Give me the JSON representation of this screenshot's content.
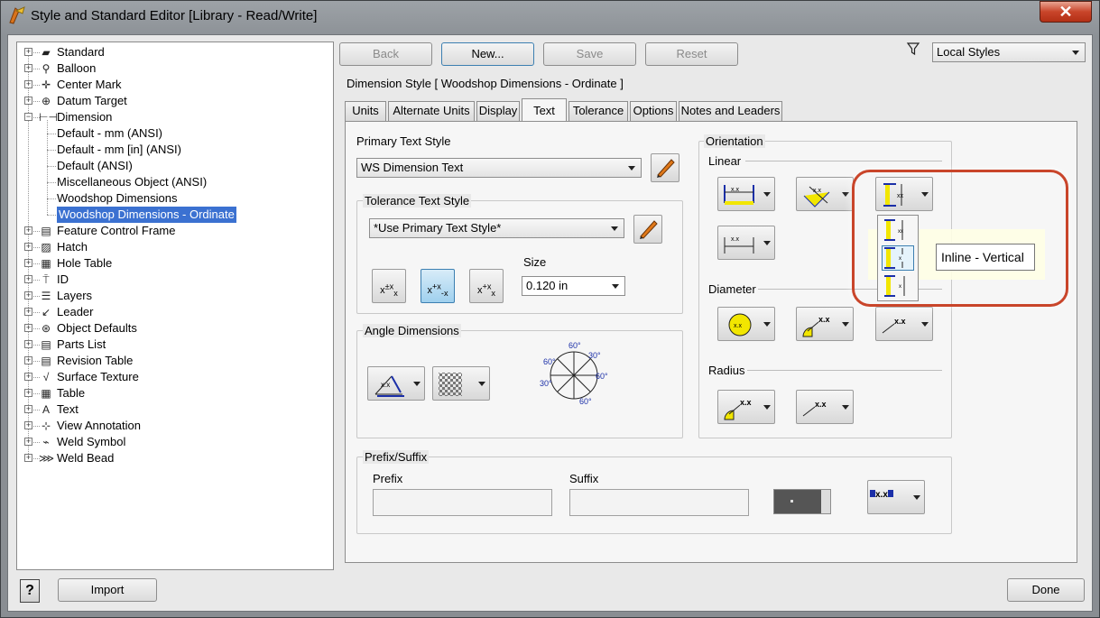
{
  "window": {
    "title": "Style and Standard Editor [Library - Read/Write]",
    "close_label": "✕"
  },
  "toolbar": {
    "back_label": "Back",
    "new_label": "New...",
    "save_label": "Save",
    "reset_label": "Reset",
    "filter_value": "Local Styles"
  },
  "tree": {
    "items": [
      {
        "label": "Standard",
        "icon": "standard-icon",
        "glyph": "▰"
      },
      {
        "label": "Balloon",
        "icon": "balloon-icon",
        "glyph": "⚲"
      },
      {
        "label": "Center Mark",
        "icon": "center-mark-icon",
        "glyph": "✛"
      },
      {
        "label": "Datum Target",
        "icon": "datum-target-icon",
        "glyph": "⊕"
      },
      {
        "label": "Dimension",
        "icon": "dimension-icon",
        "glyph": "⊢⊣"
      }
    ],
    "dimension_children": [
      {
        "label": "Default - mm (ANSI)"
      },
      {
        "label": "Default - mm [in] (ANSI)"
      },
      {
        "label": "Default (ANSI)"
      },
      {
        "label": "Miscellaneous Object (ANSI)"
      },
      {
        "label": "Woodshop Dimensions"
      },
      {
        "label": "Woodshop Dimensions - Ordinate"
      }
    ],
    "items_after": [
      {
        "label": "Feature Control Frame",
        "icon": "feature-control-frame-icon",
        "glyph": "▤"
      },
      {
        "label": "Hatch",
        "icon": "hatch-icon",
        "glyph": "▨"
      },
      {
        "label": "Hole Table",
        "icon": "hole-table-icon",
        "glyph": "▦"
      },
      {
        "label": "ID",
        "icon": "id-icon",
        "glyph": "⍑"
      },
      {
        "label": "Layers",
        "icon": "layers-icon",
        "glyph": "☰"
      },
      {
        "label": "Leader",
        "icon": "leader-icon",
        "glyph": "↙"
      },
      {
        "label": "Object Defaults",
        "icon": "object-defaults-icon",
        "glyph": "⊛"
      },
      {
        "label": "Parts List",
        "icon": "parts-list-icon",
        "glyph": "▤"
      },
      {
        "label": "Revision Table",
        "icon": "revision-table-icon",
        "glyph": "▤"
      },
      {
        "label": "Surface Texture",
        "icon": "surface-texture-icon",
        "glyph": "√"
      },
      {
        "label": "Table",
        "icon": "table-icon",
        "glyph": "▦"
      },
      {
        "label": "Text",
        "icon": "text-icon",
        "glyph": "A"
      },
      {
        "label": "View Annotation",
        "icon": "view-annotation-icon",
        "glyph": "⊹"
      },
      {
        "label": "Weld Symbol",
        "icon": "weld-symbol-icon",
        "glyph": "⌁"
      },
      {
        "label": "Weld Bead",
        "icon": "weld-bead-icon",
        "glyph": "⋙"
      }
    ]
  },
  "header": {
    "style_title": "Dimension Style [ Woodshop Dimensions - Ordinate ]"
  },
  "tabs": [
    {
      "label": "Units"
    },
    {
      "label": "Alternate Units"
    },
    {
      "label": "Display"
    },
    {
      "label": "Text"
    },
    {
      "label": "Tolerance"
    },
    {
      "label": "Options"
    },
    {
      "label": "Notes and Leaders"
    }
  ],
  "text_tab": {
    "primary_text_style_label": "Primary Text Style",
    "primary_text_style_value": "WS Dimension Text",
    "tolerance_text_style_label": "Tolerance Text Style",
    "tolerance_text_style_value": "*Use Primary Text Style*",
    "size_label": "Size",
    "size_value": "0.120 in",
    "angle_dimensions_label": "Angle Dimensions",
    "angle_labels": [
      "60°",
      "30°",
      "60°",
      "30°",
      "60°",
      "60°"
    ],
    "orientation_label": "Orientation",
    "linear_label": "Linear",
    "diameter_label": "Diameter",
    "radius_label": "Radius",
    "prefix_suffix_label": "Prefix/Suffix",
    "prefix_label": "Prefix",
    "prefix_value": "",
    "suffix_label": "Suffix",
    "suffix_value": "",
    "xx_label": "x.x",
    "tooltip": "Inline - Vertical"
  },
  "footer": {
    "help_label": "?",
    "import_label": "Import",
    "done_label": "Done"
  },
  "colors": {
    "selection": "#3b71d1",
    "highlight_ring": "#c9452a",
    "icon_yellow": "#f2e600",
    "icon_blue": "#1b2fa8"
  }
}
